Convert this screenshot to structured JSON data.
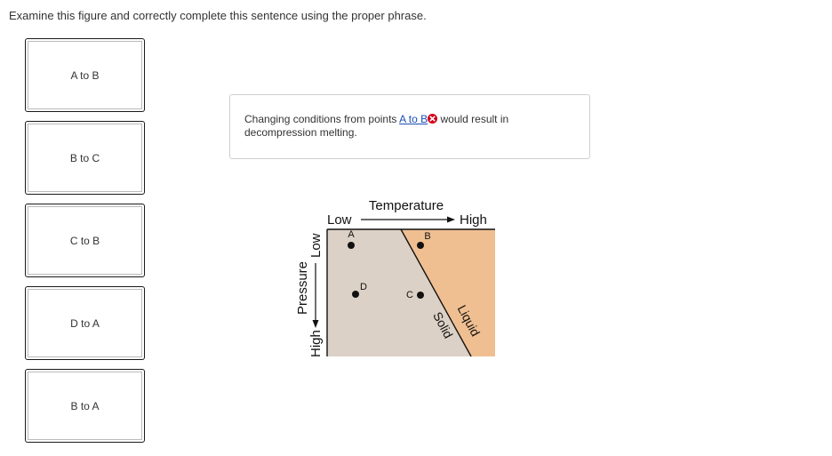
{
  "prompt": "Examine this figure and correctly complete this sentence using the proper phrase.",
  "choices": [
    {
      "label": "A to B"
    },
    {
      "label": "B to C"
    },
    {
      "label": "C to B"
    },
    {
      "label": "D to A"
    },
    {
      "label": "B to A"
    }
  ],
  "sentence": {
    "before": "Changing conditions from points ",
    "answer": "A to B",
    "after": " would result in decompression melting."
  },
  "figure": {
    "temperature_label": "Temperature",
    "temp_low": "Low",
    "temp_high": "High",
    "pressure_label": "Pressure",
    "pressure_low": "Low",
    "pressure_high": "High",
    "solid_label": "Solid",
    "liquid_label": "Liquid",
    "points": [
      "A",
      "B",
      "C",
      "D"
    ],
    "colors": {
      "solid_region": "#dcd1c6",
      "liquid_region": "#f0bf91",
      "wrong_icon": "#d0021b"
    }
  }
}
